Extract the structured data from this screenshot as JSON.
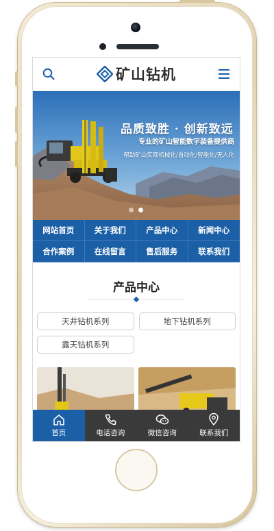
{
  "header": {
    "logo_text": "矿山钻机",
    "search_icon": "search-icon",
    "menu_icon": "hamburger-menu-icon"
  },
  "banner": {
    "tagline": "品质致胜 · 创新致远",
    "subtitle": "专业的矿山智能数字装备提供商",
    "description": "帮助矿山实现机械化/自动化/智能化/无人化",
    "slide_count": 2,
    "active_slide": 1
  },
  "nav": {
    "items": [
      "网站首页",
      "关于我们",
      "产品中心",
      "新闻中心",
      "合作案例",
      "在线留言",
      "售后服务",
      "联系我们"
    ]
  },
  "products_section": {
    "title": "产品中心",
    "categories": [
      "天井钻机系列",
      "地下钻机系列",
      "露天钻机系列"
    ]
  },
  "bottom_bar": {
    "tabs": [
      {
        "label": "首页",
        "icon": "home-icon",
        "active": true
      },
      {
        "label": "电话咨询",
        "icon": "phone-icon",
        "active": false
      },
      {
        "label": "微信咨询",
        "icon": "wechat-icon",
        "active": false
      },
      {
        "label": "联系我们",
        "icon": "location-pin-icon",
        "active": false
      }
    ]
  },
  "colors": {
    "primary_blue": "#1b5fa7",
    "bottom_bar_bg": "#3a3a3a",
    "phone_frame": "#e2d3b2"
  }
}
